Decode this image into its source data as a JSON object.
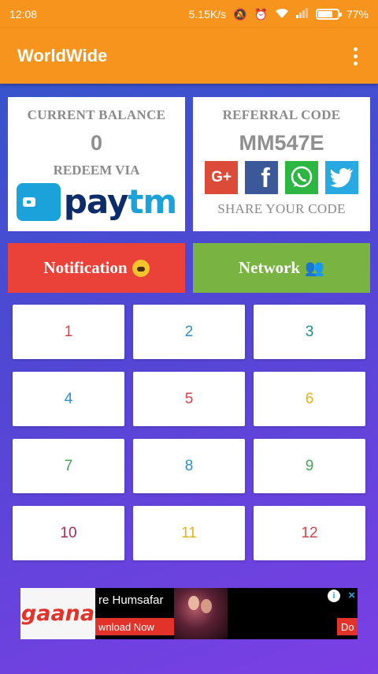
{
  "status_bar": {
    "time": "12:08",
    "speed": "5.15K/s",
    "battery": "77%",
    "icons": [
      "mute-icon",
      "alarm-icon",
      "wifi-icon",
      "signal-icon",
      "battery-icon"
    ]
  },
  "app_bar": {
    "title": "WorldWide",
    "menu_icon": "overflow-menu-icon",
    "color": "#f7941d"
  },
  "balance_card": {
    "label": "CURRENT BALANCE",
    "value": "0",
    "redeem_label": "REDEEM VIA",
    "redeem_logo_pay": "pay",
    "redeem_logo_tm": "tm"
  },
  "referral_card": {
    "label": "REFERRAL CODE",
    "code": "MM547E",
    "share_label": "SHARE YOUR CODE",
    "social": [
      {
        "name": "google-plus",
        "glyph": "G+",
        "color": "#dc4a38"
      },
      {
        "name": "facebook",
        "glyph": "f",
        "color": "#3b5998"
      },
      {
        "name": "whatsapp",
        "glyph": "",
        "color": "#2bb741"
      },
      {
        "name": "twitter",
        "glyph": "",
        "color": "#29a9e1"
      }
    ]
  },
  "actions": {
    "notification_label": "Notification",
    "network_label": "Network",
    "notification_color": "#ea4239",
    "network_color": "#79b342"
  },
  "grid": {
    "tiles": [
      {
        "label": "1",
        "color": "#d8434a"
      },
      {
        "label": "2",
        "color": "#2f8fd1"
      },
      {
        "label": "3",
        "color": "#1f8c8c"
      },
      {
        "label": "4",
        "color": "#2f8fd1"
      },
      {
        "label": "5",
        "color": "#d8434a"
      },
      {
        "label": "6",
        "color": "#e8b31c"
      },
      {
        "label": "7",
        "color": "#4aa35a"
      },
      {
        "label": "8",
        "color": "#2f8fd1"
      },
      {
        "label": "9",
        "color": "#4aa35a"
      },
      {
        "label": "10",
        "color": "#b0284f"
      },
      {
        "label": "11",
        "color": "#e8b31c"
      },
      {
        "label": "12",
        "color": "#d8434a"
      }
    ]
  },
  "ad": {
    "brand": "gaana",
    "title": "re Humsafar",
    "cta": "wnload Now",
    "cta_right": "Do",
    "info": "i",
    "close": "×"
  }
}
